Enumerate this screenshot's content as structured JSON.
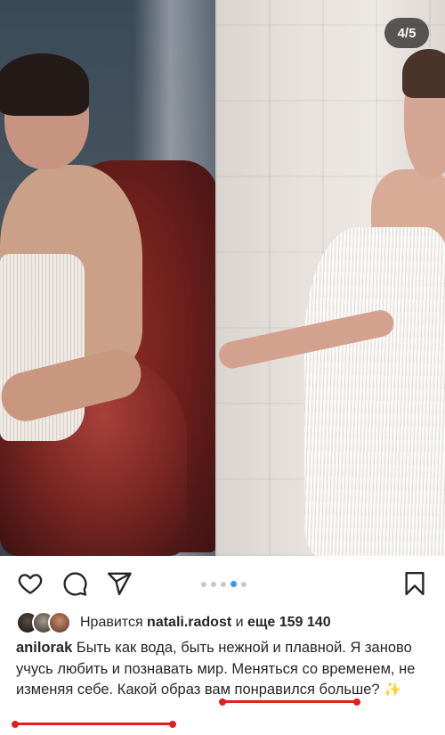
{
  "carousel": {
    "counter": "4/5",
    "images": [
      "woman-in-fringe-dress-on-red-chair",
      "woman-in-white-fringe-dress-dancing"
    ],
    "dots_total": 5,
    "active_dot": 4,
    "colors": {
      "indicator_active": "#3897f0",
      "indicator_inactive": "#c7c7c7"
    }
  },
  "actions": {
    "like_icon": "heart-icon",
    "comment_icon": "comment-bubble-icon",
    "share_icon": "paper-plane-icon",
    "save_icon": "bookmark-icon"
  },
  "likes": {
    "prefix": "Нравится ",
    "user": "natali.radost",
    "middle": " и ",
    "others": "еще 159 140"
  },
  "caption": {
    "username": "anilorak",
    "text": " Быть как вода, быть нежной и плавной. Я заново учусь любить и познавать мир. Меняться со временем, не изменяя себе. ",
    "question": "Какой образ вам понравился больше?",
    "emoji": "✨",
    "highlight_color": "#e0201d"
  }
}
